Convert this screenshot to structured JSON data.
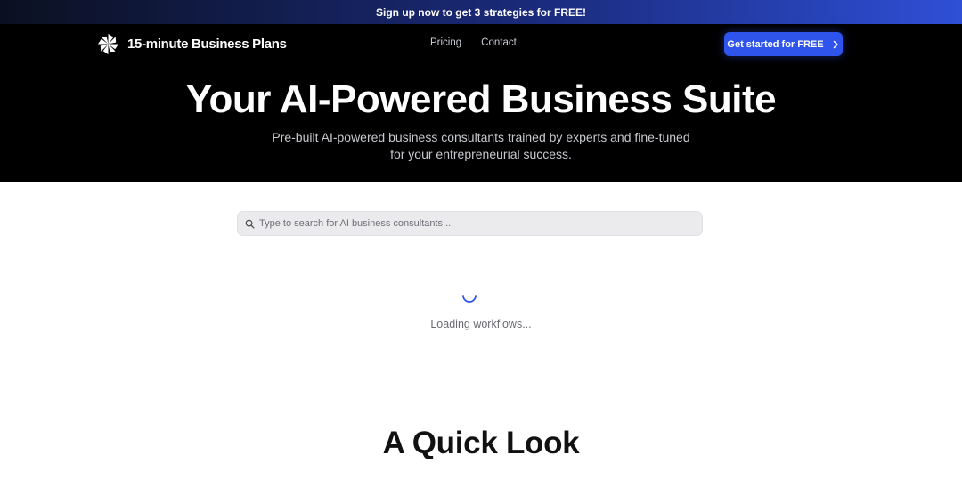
{
  "promo": {
    "text": "Sign up now to get 3 strategies for FREE!"
  },
  "header": {
    "logo_text": "15-minute Business Plans",
    "logo_icon": "pinwheel-logo-icon",
    "nav": [
      {
        "label": "Pricing"
      },
      {
        "label": "Contact"
      }
    ],
    "cta_label": "Get started for FREE",
    "cta_icon": "chevron-right-icon"
  },
  "hero": {
    "title": "Your AI-Powered Business Suite",
    "subtitle": "Pre-built AI-powered business consultants trained by experts and fine-tuned for your entrepreneurial success."
  },
  "search": {
    "placeholder": "Type to search for AI business consultants...",
    "value": "",
    "icon": "search-icon"
  },
  "loading": {
    "text": "Loading workflows..."
  },
  "section": {
    "title": "A Quick Look"
  },
  "colors": {
    "accent": "#2f54eb",
    "hero_bg": "#000000",
    "spinner": "#2f54eb"
  }
}
